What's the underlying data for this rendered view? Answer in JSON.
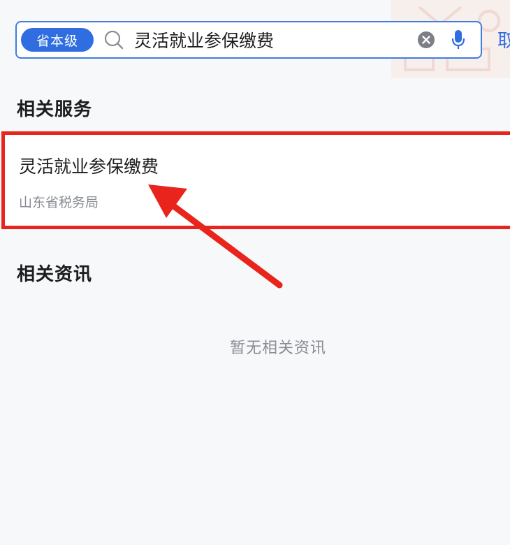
{
  "search": {
    "level_label": "省本级",
    "query": "灵活就业参保缴费",
    "cancel_edge": "取"
  },
  "services": {
    "title": "相关服务",
    "items": [
      {
        "name": "灵活就业参保缴费",
        "department": "山东省税务局"
      }
    ]
  },
  "news": {
    "title": "相关资讯",
    "empty_text": "暂无相关资讯"
  },
  "colors": {
    "accent": "#2f6de0",
    "highlight_border": "#e8241d",
    "arrow": "#e8241d"
  },
  "icons": [
    "search-icon",
    "clear-icon",
    "microphone-icon",
    "annotation-arrow"
  ]
}
